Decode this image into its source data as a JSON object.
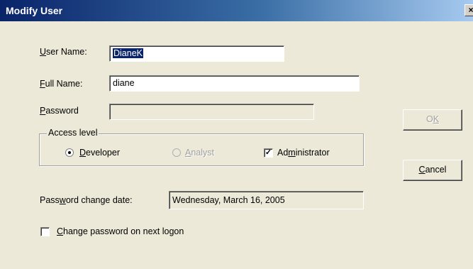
{
  "window": {
    "title": "Modify User",
    "close_glyph": "×"
  },
  "user_name": {
    "label_first": "U",
    "label_rest": "ser Name:",
    "value": "DianeK"
  },
  "full_name": {
    "label_first": "F",
    "label_rest": "ull Name:",
    "value": "diane"
  },
  "password": {
    "label_first": "P",
    "label_rest": "assword",
    "value": ""
  },
  "access_level": {
    "legend": "Access level",
    "developer": {
      "label_first": "D",
      "label_rest": "eveloper",
      "selected": true
    },
    "analyst": {
      "label_first": "A",
      "label_rest": "nalyst",
      "selected": false,
      "enabled": false
    },
    "administrator": {
      "label_pre": "Ad",
      "label_u": "m",
      "label_post": "inistrator",
      "checked": true,
      "check_glyph": "✓"
    }
  },
  "password_change_date": {
    "label_pre": "Pass",
    "label_u": "w",
    "label_post": "ord change date:",
    "value": "Wednesday, March 16, 2005"
  },
  "change_password_next_logon": {
    "label_first": "C",
    "label_rest": "hange password on next logon",
    "checked": false
  },
  "buttons": {
    "ok": {
      "label_pre": "O",
      "label_u": "K",
      "enabled": false
    },
    "cancel": {
      "label_first": "C",
      "label_rest": "ancel"
    }
  }
}
